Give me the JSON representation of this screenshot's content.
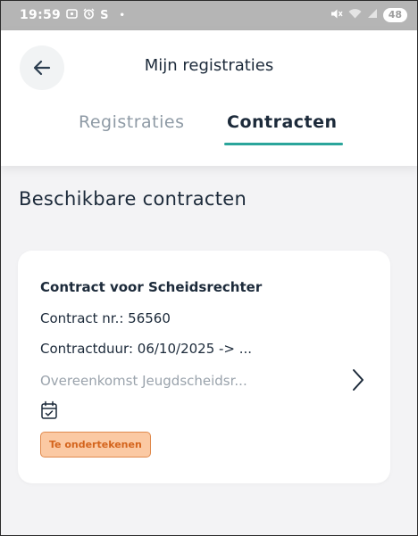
{
  "status_bar": {
    "time": "19:59",
    "left_icons": [
      "screenshot-icon",
      "alarm-icon"
    ],
    "carrier_letter": "S",
    "dot": "•",
    "battery": "48",
    "right_icons": [
      "mute-icon",
      "wifi-icon",
      "signal-icon"
    ]
  },
  "header": {
    "title": "Mijn registraties",
    "back_icon": "arrow-left-icon",
    "tabs": [
      {
        "label": "Registraties",
        "active": false
      },
      {
        "label": "Contracten",
        "active": true
      }
    ],
    "accent_color": "#2aa59b"
  },
  "main": {
    "section_title": "Beschikbare contracten",
    "contracts": [
      {
        "title": "Contract voor Scheidsrechter",
        "number_line": "Contract nr.: 56560",
        "duration_line": "Contractduur: 06/10/2025 -> ...",
        "description": "Overeenkomst Jeugdscheidsr...",
        "date_icon": "calendar-check-icon",
        "status_badge": "Te ondertekenen",
        "badge_color": "#fbc9a3",
        "open_icon": "chevron-right-icon"
      }
    ]
  }
}
